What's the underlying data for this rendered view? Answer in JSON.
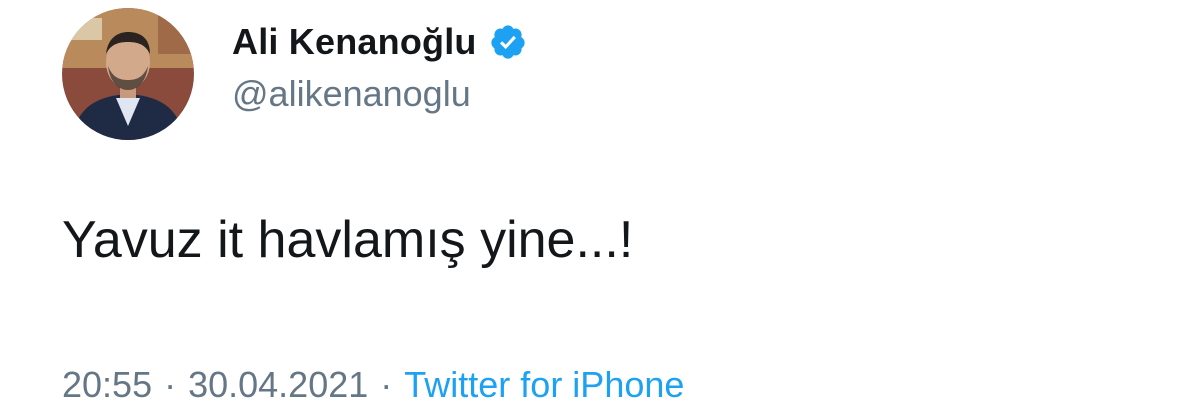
{
  "author": {
    "display_name": "Ali Kenanoğlu",
    "handle": "@alikenanoglu",
    "verified_icon": "verified-badge-icon",
    "avatar_icon": "profile-avatar"
  },
  "tweet": {
    "text": "Yavuz it havlamış yine...!"
  },
  "meta": {
    "time": "20:55",
    "separator": "·",
    "date": "30.04.2021",
    "source": "Twitter for iPhone"
  },
  "colors": {
    "text_primary": "#14171a",
    "text_secondary": "#657786",
    "accent": "#1da1f2"
  }
}
